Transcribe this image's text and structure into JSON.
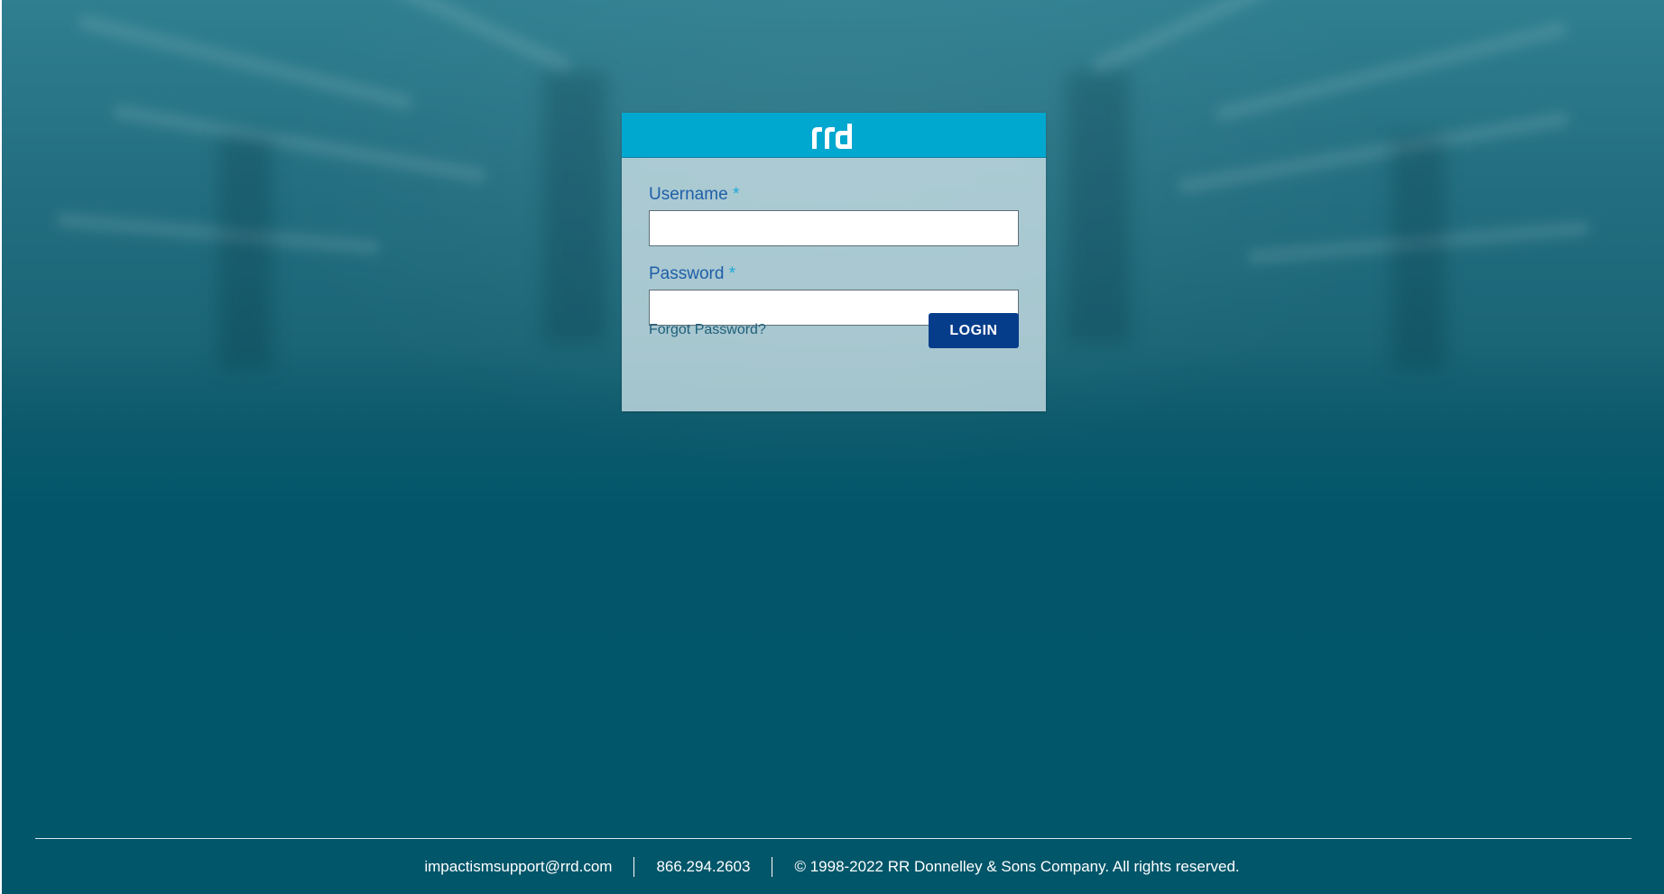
{
  "login": {
    "logo_text": "rrd",
    "username_label": "Username",
    "password_label": "Password",
    "required_marker": "*",
    "username_value": "",
    "password_value": "",
    "forgot_password": "Forgot Password?",
    "login_button": "LOGIN"
  },
  "footer": {
    "email": "impactismsupport@rrd.com",
    "phone": "866.294.2603",
    "copyright": "© 1998-2022 RR Donnelley & Sons Company. All rights reserved."
  },
  "colors": {
    "header_accent": "#00a7cf",
    "button": "#063d8b",
    "label": "#1f5fa8",
    "background": "#03566a"
  }
}
